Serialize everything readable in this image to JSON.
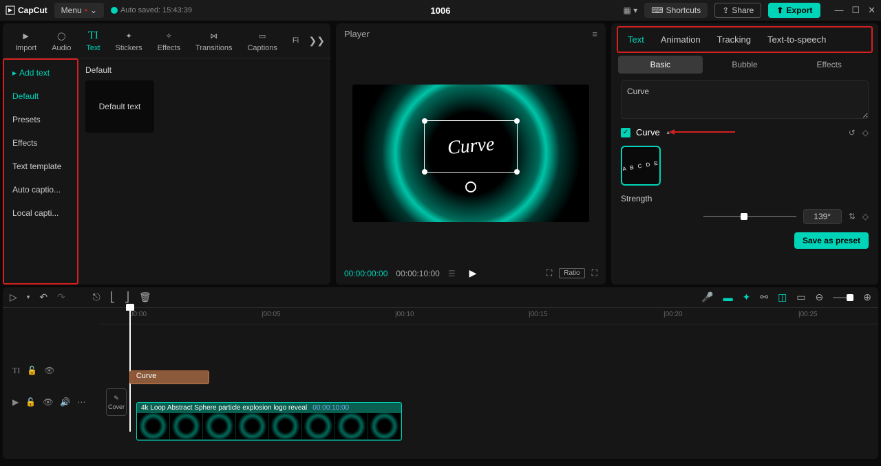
{
  "titlebar": {
    "logo": "CapCut",
    "menu": "Menu",
    "autosave": "Auto saved: 15:43:39",
    "project_title": "1006",
    "shortcuts": "Shortcuts",
    "share": "Share",
    "export": "Export"
  },
  "top_tabs": [
    {
      "label": "Import"
    },
    {
      "label": "Audio"
    },
    {
      "label": "Text"
    },
    {
      "label": "Stickers"
    },
    {
      "label": "Effects"
    },
    {
      "label": "Transitions"
    },
    {
      "label": "Captions"
    },
    {
      "label": "Fi"
    }
  ],
  "sidebar": {
    "header": "Add text",
    "items": [
      "Default",
      "Presets",
      "Effects",
      "Text template",
      "Auto captio...",
      "Local capti..."
    ]
  },
  "content": {
    "header": "Default",
    "card_label": "Default text"
  },
  "player": {
    "title": "Player",
    "text_content": "Curve",
    "time_current": "00:00:00:00",
    "time_total": "00:00:10:00",
    "ratio": "Ratio"
  },
  "right_panel": {
    "tabs": [
      "Text",
      "Animation",
      "Tracking",
      "Text-to-speech"
    ],
    "sub_tabs": [
      "Basic",
      "Bubble",
      "Effects"
    ],
    "text_value": "Curve",
    "curve_section": "Curve",
    "curve_letters": "A B C D E",
    "strength_label": "Strength",
    "strength_value": "139°",
    "save_preset": "Save as preset"
  },
  "timeline": {
    "ruler": [
      "00:00",
      "|00:05",
      "|00:10",
      "|00:15",
      "|00:20",
      "|00:25"
    ],
    "text_clip": "Curve",
    "video_clip_name": "4k Loop Abstract Sphere particle explosion logo reveal",
    "video_clip_time": "00:00:10:00",
    "cover": "Cover"
  }
}
